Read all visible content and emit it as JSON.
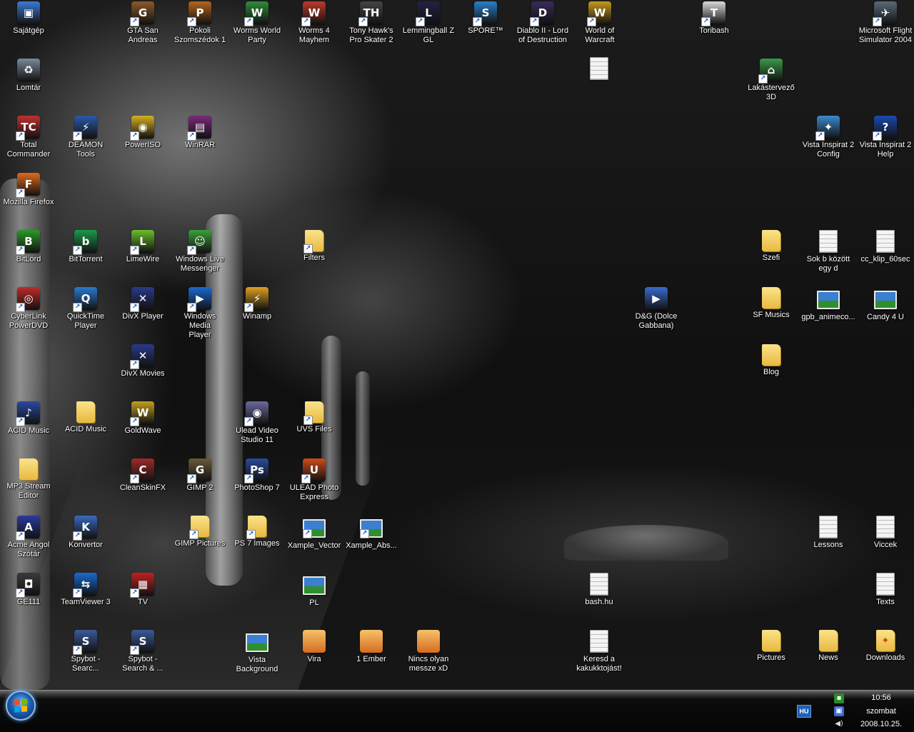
{
  "desktop": {
    "icons": [
      {
        "label": "Sajátgép",
        "icon": "computer-icon",
        "color": "#3a7bd5",
        "glyph": "▣",
        "kind": "app",
        "shortcut": false
      },
      {
        "label": "GTA San\nAndreas",
        "icon": "gta-icon",
        "color": "#8b5a2b",
        "glyph": "G",
        "kind": "app",
        "shortcut": true
      },
      {
        "label": "Pokoli\nSzomszédok 1",
        "icon": "neighbours-icon",
        "color": "#b5651d",
        "glyph": "P",
        "kind": "app",
        "shortcut": true
      },
      {
        "label": "Worms World\nParty",
        "icon": "worms-world-icon",
        "color": "#2e8b3a",
        "glyph": "W",
        "kind": "app",
        "shortcut": true
      },
      {
        "label": "Worms 4\nMayhem",
        "icon": "worms4-icon",
        "color": "#c0392b",
        "glyph": "W",
        "kind": "app",
        "shortcut": true
      },
      {
        "label": "Tony Hawk's\nPro Skater 2",
        "icon": "tony-hawk-icon",
        "color": "#444444",
        "glyph": "TH",
        "kind": "app",
        "shortcut": true
      },
      {
        "label": "Lemmingball Z\nGL",
        "icon": "lemmingball-icon",
        "color": "#222244",
        "glyph": "L",
        "kind": "app",
        "shortcut": true
      },
      {
        "label": "SPORE™",
        "icon": "spore-icon",
        "color": "#2a7fc9",
        "glyph": "S",
        "kind": "app",
        "shortcut": true
      },
      {
        "label": "Diablo II - Lord\nof Destruction",
        "icon": "diablo-icon",
        "color": "#3a2a5a",
        "glyph": "D",
        "kind": "app",
        "shortcut": true
      },
      {
        "label": "World of\nWarcraft",
        "icon": "wow-icon",
        "color": "#c79a1e",
        "glyph": "W",
        "kind": "app",
        "shortcut": true
      },
      {
        "label": "Toribash",
        "icon": "toribash-icon",
        "color": "#d9d9d9",
        "glyph": "T",
        "kind": "app",
        "shortcut": true
      },
      {
        "label": "Microsoft Flight\nSimulator 2004",
        "icon": "airplane-icon",
        "color": "#5a6a7a",
        "glyph": "✈",
        "kind": "app",
        "shortcut": true
      },
      {
        "label": "",
        "icon": "blank-document-icon",
        "color": "#f4f4f4",
        "glyph": "",
        "kind": "doc",
        "shortcut": false
      },
      {
        "label": "Lomtár",
        "icon": "recycle-bin-icon",
        "color": "#7a8a9a",
        "glyph": "♻",
        "kind": "app",
        "shortcut": false
      },
      {
        "label": "Lakástervező\n3D",
        "icon": "house-planner-icon",
        "color": "#3a9a4a",
        "glyph": "⌂",
        "kind": "app",
        "shortcut": true
      },
      {
        "label": "Total\nCommander",
        "icon": "total-commander-icon",
        "color": "#c03030",
        "glyph": "TC",
        "kind": "app",
        "shortcut": true
      },
      {
        "label": "DEAMON Tools",
        "icon": "daemon-tools-icon",
        "color": "#2a5aaa",
        "glyph": "⚡",
        "kind": "app",
        "shortcut": true
      },
      {
        "label": "PowerISO",
        "icon": "poweriso-icon",
        "color": "#d4b020",
        "glyph": "◉",
        "kind": "app",
        "shortcut": true
      },
      {
        "label": "WinRAR",
        "icon": "winrar-icon",
        "color": "#7a2a7a",
        "glyph": "▤",
        "kind": "app",
        "shortcut": true
      },
      {
        "label": "Vista Inspirat 2\nConfig",
        "icon": "vista-config-icon",
        "color": "#3a8ad0",
        "glyph": "✦",
        "kind": "app",
        "shortcut": true
      },
      {
        "label": "Vista Inspirat 2\nHelp",
        "icon": "help-icon",
        "color": "#1a4ab0",
        "glyph": "?",
        "kind": "app",
        "shortcut": true
      },
      {
        "label": "Mozilla Firefox",
        "icon": "firefox-icon",
        "color": "#e06a1a",
        "glyph": "F",
        "kind": "app",
        "shortcut": true
      },
      {
        "label": "BitLord",
        "icon": "bitlord-icon",
        "color": "#2a9a2a",
        "glyph": "B",
        "kind": "app",
        "shortcut": true
      },
      {
        "label": "BitTorrent",
        "icon": "bittorrent-icon",
        "color": "#1a9a4a",
        "glyph": "b",
        "kind": "app",
        "shortcut": true
      },
      {
        "label": "LimeWire",
        "icon": "limewire-icon",
        "color": "#6abf2a",
        "glyph": "L",
        "kind": "app",
        "shortcut": true
      },
      {
        "label": "Windows Live\nMessenger",
        "icon": "messenger-icon",
        "color": "#3aa03a",
        "glyph": "☺",
        "kind": "app",
        "shortcut": true
      },
      {
        "label": "Filters",
        "icon": "folder-icon",
        "color": "#e8b93f",
        "glyph": "",
        "kind": "folder",
        "shortcut": true
      },
      {
        "label": "Szefi",
        "icon": "folder-icon",
        "color": "#e8b93f",
        "glyph": "",
        "kind": "folder",
        "shortcut": false
      },
      {
        "label": "Sok b között\negy d",
        "icon": "text-document-icon",
        "color": "#f4f4f4",
        "glyph": "",
        "kind": "doc",
        "shortcut": false
      },
      {
        "label": "cc_klip_60sec",
        "icon": "media-document-icon",
        "color": "#f4f4f4",
        "glyph": "",
        "kind": "doc",
        "shortcut": false
      },
      {
        "label": "CyberLink\nPowerDVD",
        "icon": "powerdvd-icon",
        "color": "#c02a2a",
        "glyph": "◎",
        "kind": "app",
        "shortcut": true
      },
      {
        "label": "QuickTime\nPlayer",
        "icon": "quicktime-icon",
        "color": "#2a7ad0",
        "glyph": "Q",
        "kind": "app",
        "shortcut": true
      },
      {
        "label": "DivX Player",
        "icon": "divx-player-icon",
        "color": "#2a3a8a",
        "glyph": "✕",
        "kind": "app",
        "shortcut": true
      },
      {
        "label": "Windows Media\nPlayer",
        "icon": "media-player-icon",
        "color": "#1a6ad0",
        "glyph": "▶",
        "kind": "app",
        "shortcut": true
      },
      {
        "label": "Winamp",
        "icon": "winamp-icon",
        "color": "#e0a020",
        "glyph": "⚡",
        "kind": "app",
        "shortcut": true
      },
      {
        "label": "D&G (Dolce\nGabbana)",
        "icon": "video-file-icon",
        "color": "#3a6ad0",
        "glyph": "▶",
        "kind": "app",
        "shortcut": false
      },
      {
        "label": "SF Musics",
        "icon": "folder-icon",
        "color": "#e8b93f",
        "glyph": "",
        "kind": "folder",
        "shortcut": false
      },
      {
        "label": "gpb_animeco...",
        "icon": "image-file-icon",
        "color": "#3a7fd0",
        "glyph": "",
        "kind": "pic",
        "shortcut": false
      },
      {
        "label": "Candy 4 U",
        "icon": "image-file-icon",
        "color": "#3a7fd0",
        "glyph": "",
        "kind": "pic",
        "shortcut": false
      },
      {
        "label": "DivX Movies",
        "icon": "divx-movies-icon",
        "color": "#2a3a8a",
        "glyph": "✕",
        "kind": "app",
        "shortcut": true
      },
      {
        "label": "Blog",
        "icon": "folder-icon",
        "color": "#e8b93f",
        "glyph": "",
        "kind": "folder",
        "shortcut": false
      },
      {
        "label": "ACID Music",
        "icon": "acid-music-icon",
        "color": "#2a4aa0",
        "glyph": "♪",
        "kind": "app",
        "shortcut": true
      },
      {
        "label": "ACID Music",
        "icon": "folder-icon",
        "color": "#e8b93f",
        "glyph": "",
        "kind": "folder",
        "shortcut": false
      },
      {
        "label": "GoldWave",
        "icon": "goldwave-icon",
        "color": "#c0a020",
        "glyph": "W",
        "kind": "app",
        "shortcut": true
      },
      {
        "label": "Ulead Video\nStudio 11",
        "icon": "ulead-video-icon",
        "color": "#6a6aa0",
        "glyph": "◉",
        "kind": "app",
        "shortcut": true
      },
      {
        "label": "UVS Files",
        "icon": "folder-icon",
        "color": "#e8b93f",
        "glyph": "",
        "kind": "folder",
        "shortcut": true
      },
      {
        "label": "MP3 Stream\nEditor",
        "icon": "folder-icon",
        "color": "#e8b93f",
        "glyph": "",
        "kind": "folder",
        "shortcut": false
      },
      {
        "label": "CleanSkinFX",
        "icon": "cleanskin-icon",
        "color": "#a02a2a",
        "glyph": "C",
        "kind": "app",
        "shortcut": true
      },
      {
        "label": "GIMP 2",
        "icon": "gimp-icon",
        "color": "#6a5a3a",
        "glyph": "G",
        "kind": "app",
        "shortcut": true
      },
      {
        "label": "PhotoShop 7",
        "icon": "photoshop-icon",
        "color": "#2a4a9a",
        "glyph": "Ps",
        "kind": "app",
        "shortcut": true
      },
      {
        "label": "ULEAD Photo\nExpress",
        "icon": "ulead-photo-icon",
        "color": "#d04a1a",
        "glyph": "U",
        "kind": "app",
        "shortcut": true
      },
      {
        "label": "Acme Angol\nSzótár",
        "icon": "dictionary-icon",
        "color": "#2a3aa0",
        "glyph": "A",
        "kind": "app",
        "shortcut": true
      },
      {
        "label": "Konvertor",
        "icon": "konvertor-icon",
        "color": "#3a6ac0",
        "glyph": "K",
        "kind": "app",
        "shortcut": true
      },
      {
        "label": "GIMP Pictures",
        "icon": "folder-icon",
        "color": "#e8b93f",
        "glyph": "",
        "kind": "folder",
        "shortcut": true
      },
      {
        "label": "PS 7 Images",
        "icon": "folder-icon",
        "color": "#e8b93f",
        "glyph": "",
        "kind": "folder",
        "shortcut": true
      },
      {
        "label": "Xample_Vector",
        "icon": "image-file-icon",
        "color": "#3a7fd0",
        "glyph": "",
        "kind": "pic",
        "shortcut": true
      },
      {
        "label": "Xample_Abs...",
        "icon": "image-file-icon",
        "color": "#3a7fd0",
        "glyph": "",
        "kind": "pic",
        "shortcut": true
      },
      {
        "label": "Lessons",
        "icon": "text-document-icon",
        "color": "#f4f4f4",
        "glyph": "",
        "kind": "doc",
        "shortcut": false
      },
      {
        "label": "Viccek",
        "icon": "text-document-icon",
        "color": "#f4f4f4",
        "glyph": "",
        "kind": "doc",
        "shortcut": false
      },
      {
        "label": "GE111",
        "icon": "camera-icon",
        "color": "#3a3a3a",
        "glyph": "◘",
        "kind": "app",
        "shortcut": true
      },
      {
        "label": "TeamViewer 3",
        "icon": "teamviewer-icon",
        "color": "#1a6ad0",
        "glyph": "⇆",
        "kind": "app",
        "shortcut": true
      },
      {
        "label": "TV",
        "icon": "tv-icon",
        "color": "#c02020",
        "glyph": "▦",
        "kind": "app",
        "shortcut": true
      },
      {
        "label": "PL",
        "icon": "image-file-icon",
        "color": "#3a7fd0",
        "glyph": "",
        "kind": "pic",
        "shortcut": false
      },
      {
        "label": "bash.hu",
        "icon": "text-document-icon",
        "color": "#f4f4f4",
        "glyph": "",
        "kind": "doc",
        "shortcut": false
      },
      {
        "label": "Texts",
        "icon": "text-document-icon",
        "color": "#f4f4f4",
        "glyph": "",
        "kind": "doc",
        "shortcut": false
      },
      {
        "label": "Spybot -\nSearc...",
        "icon": "spybot-icon",
        "color": "#3a5a9a",
        "glyph": "S",
        "kind": "app",
        "shortcut": true
      },
      {
        "label": "Spybot -\nSearch & ...",
        "icon": "spybot-icon",
        "color": "#3a5a9a",
        "glyph": "S",
        "kind": "app",
        "shortcut": true
      },
      {
        "label": "Vista\nBackground",
        "icon": "image-file-icon",
        "color": "#3a7fd0",
        "glyph": "",
        "kind": "pic",
        "shortcut": false
      },
      {
        "label": "Vira",
        "icon": "image-file-icon",
        "color": "#d06a2a",
        "glyph": "",
        "kind": "orange",
        "shortcut": false
      },
      {
        "label": "1 Ember",
        "icon": "image-file-icon",
        "color": "#d06a2a",
        "glyph": "",
        "kind": "orange",
        "shortcut": false
      },
      {
        "label": "Nincs olyan\nmessze xD",
        "icon": "image-file-icon",
        "color": "#d06a2a",
        "glyph": "",
        "kind": "orange",
        "shortcut": false
      },
      {
        "label": "Keresd a\nkakukktojást!",
        "icon": "text-document-icon",
        "color": "#f4f4f4",
        "glyph": "",
        "kind": "doc",
        "shortcut": false
      },
      {
        "label": "Pictures",
        "icon": "folder-icon",
        "color": "#e8b93f",
        "glyph": "",
        "kind": "folder",
        "shortcut": false
      },
      {
        "label": "News",
        "icon": "folder-icon",
        "color": "#e8b93f",
        "glyph": "",
        "kind": "folder",
        "shortcut": false
      },
      {
        "label": "Downloads",
        "icon": "downloads-folder-icon",
        "color": "#e8b93f",
        "glyph": "✦",
        "kind": "folder",
        "shortcut": false
      }
    ]
  },
  "taskbar": {
    "language": "HU",
    "time": "10:56",
    "day": "szombat",
    "date": "2008.10.25."
  }
}
